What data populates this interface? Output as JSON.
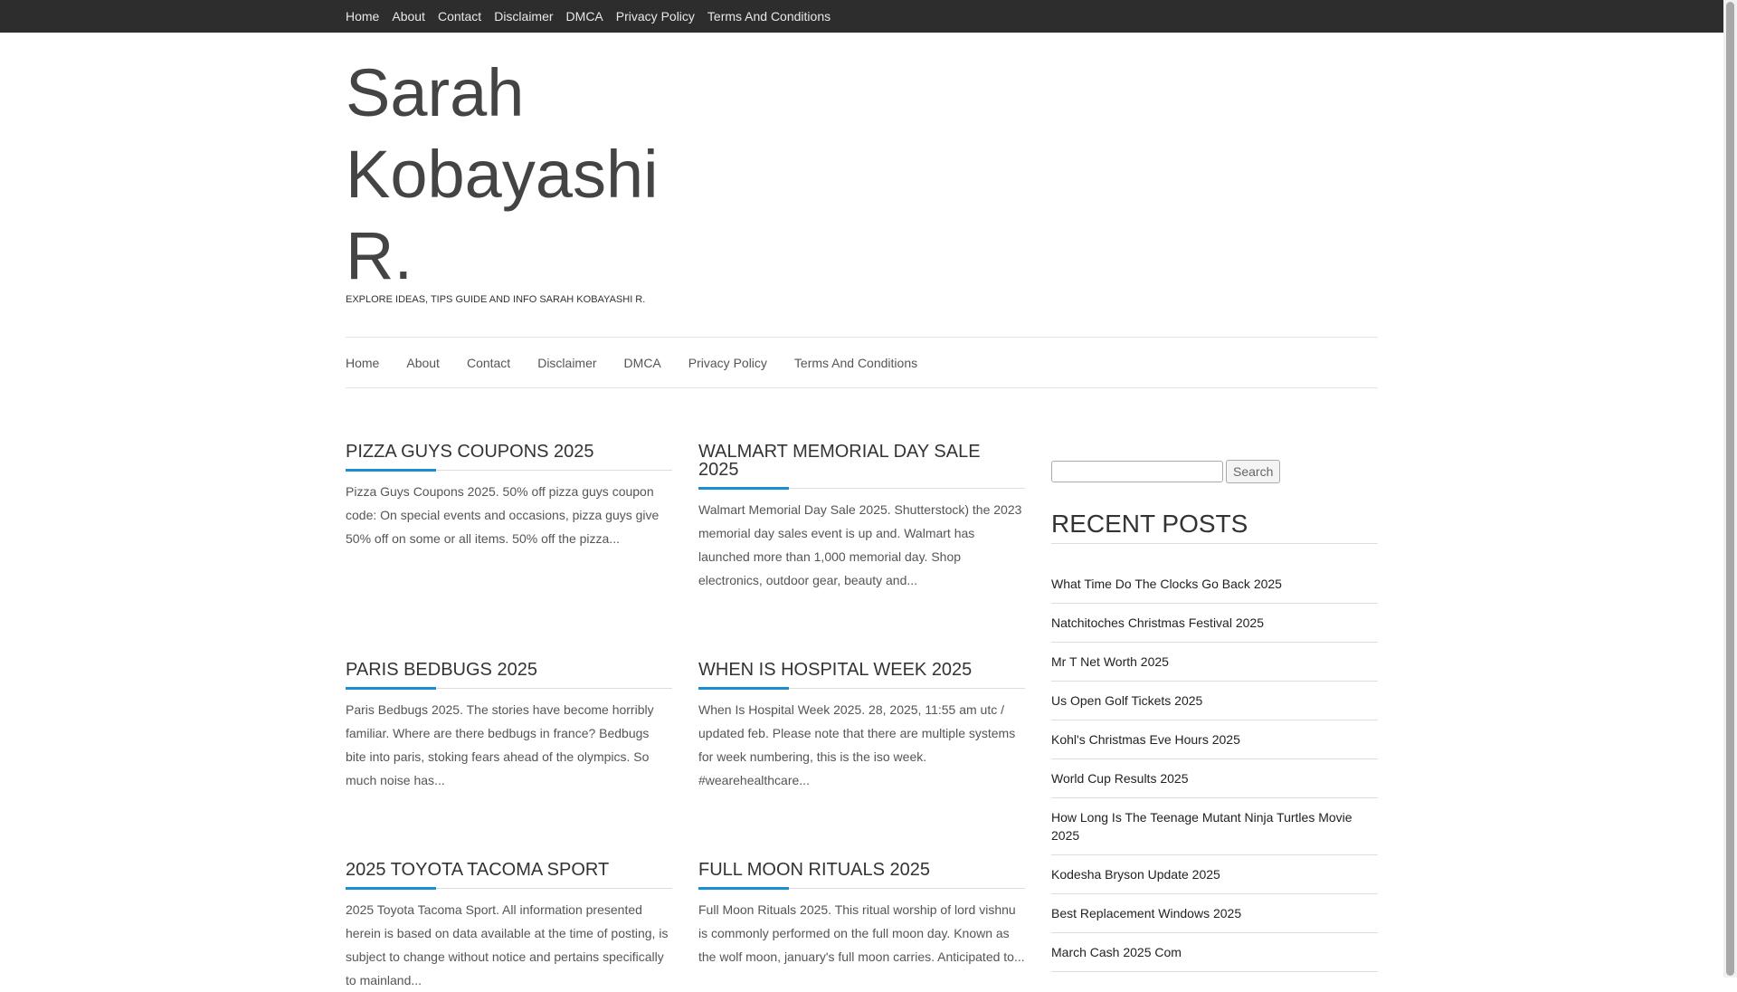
{
  "top_nav": [
    "Home",
    "About",
    "Contact",
    "Disclaimer",
    "DMCA",
    "Privacy Policy",
    "Terms And Conditions"
  ],
  "site": {
    "title": "Sarah Kobayashi R.",
    "description": "EXPLORE IDEAS, TIPS GUIDE AND INFO SARAH KOBAYASHI R."
  },
  "main_nav": [
    "Home",
    "About",
    "Contact",
    "Disclaimer",
    "DMCA",
    "Privacy Policy",
    "Terms And Conditions"
  ],
  "posts": [
    {
      "title": "PIZZA GUYS COUPONS 2025",
      "excerpt": "Pizza Guys Coupons 2025. 50% off pizza guys coupon code: On special events and occasions, pizza guys give 50% off on some or all items. 50% off the pizza..."
    },
    {
      "title": "WALMART MEMORIAL DAY SALE 2025",
      "excerpt": "Walmart Memorial Day Sale 2025. Shutterstock) the 2023 memorial day sales event is up and. Walmart has launched more than 1,000 memorial day. Shop electronics, outdoor gear, beauty and..."
    },
    {
      "title": "PARIS BEDBUGS 2025",
      "excerpt": "Paris Bedbugs 2025. The stories have become horribly familiar. Where are there bedbugs in france? Bedbugs bite into paris, stoking fears ahead of the olympics. So much noise has..."
    },
    {
      "title": "WHEN IS HOSPITAL WEEK 2025",
      "excerpt": "When Is Hospital Week 2025. 28, 2025, 11:55 am utc / updated feb. Please note that there are multiple systems for week numbering, this is the iso week. #wearehealthcare..."
    },
    {
      "title": "2025 TOYOTA TACOMA SPORT",
      "excerpt": "2025 Toyota Tacoma Sport. All information presented herein is based on data available at the time of posting, is subject to change without notice and pertains specifically to mainland..."
    },
    {
      "title": "FULL MOON RITUALS 2025",
      "excerpt": "Full Moon Rituals 2025. This ritual worship of lord vishnu is commonly performed on the full moon day. Known as the wolf moon, january's full moon carries. Anticipated to..."
    }
  ],
  "sidebar": {
    "search_button": "Search",
    "recent_title": "RECENT POSTS",
    "recent_posts": [
      "What Time Do The Clocks Go Back 2025",
      "Natchitoches Christmas Festival 2025",
      "Mr T Net Worth 2025",
      "Us Open Golf Tickets 2025",
      "Kohl's Christmas Eve Hours 2025",
      "World Cup Results 2025",
      "How Long Is The Teenage Mutant Ninja Turtles Movie 2025",
      "Kodesha Bryson Update 2025",
      "Best Replacement Windows 2025",
      "March Cash 2025 Com"
    ]
  }
}
